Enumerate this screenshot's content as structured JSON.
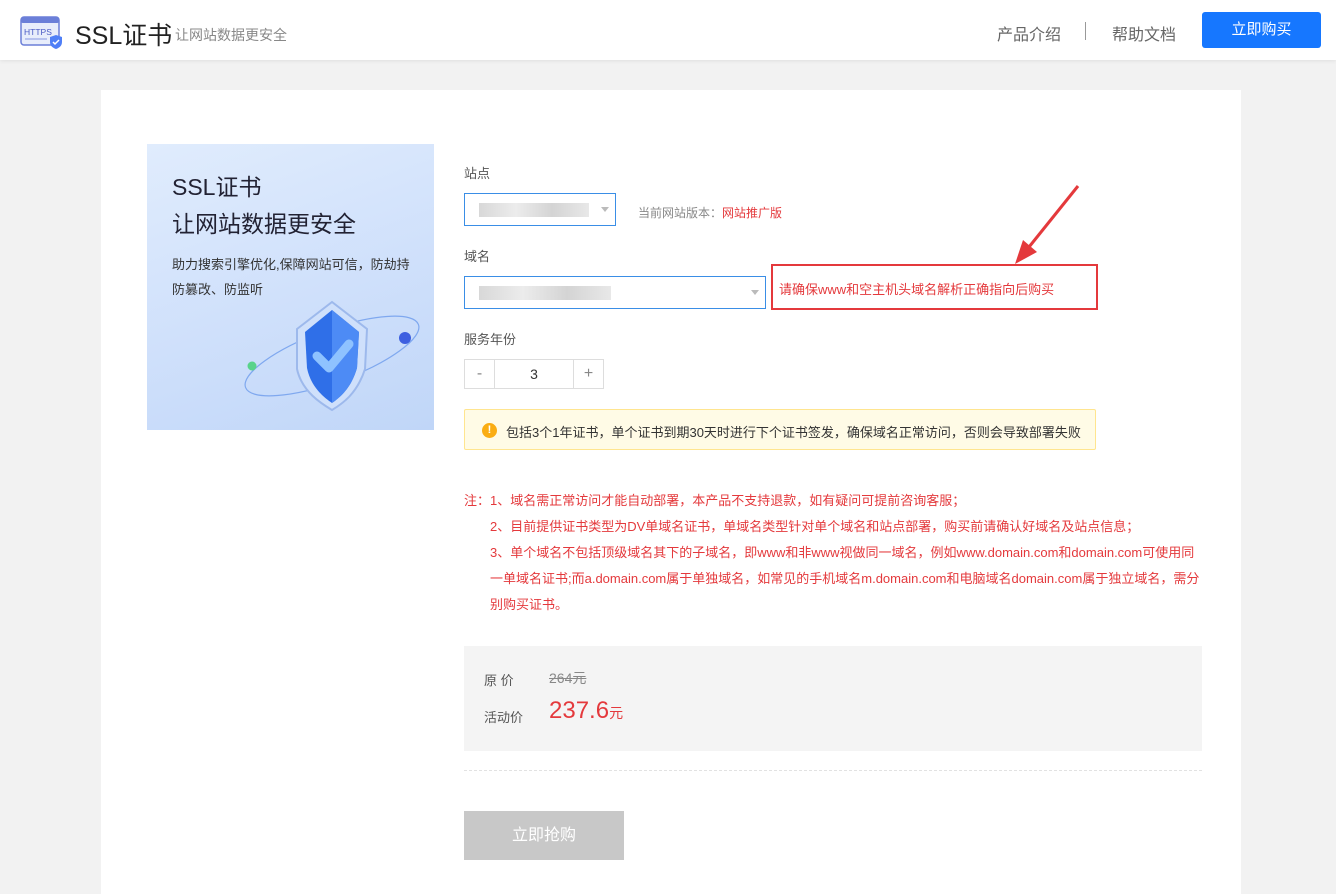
{
  "header": {
    "brand": "SSL证书",
    "tagline": "让网站数据更安全",
    "logo_icon": "https-certificate-icon",
    "nav": [
      "产品介绍",
      "帮助文档"
    ],
    "buy_label": "立即购买",
    "accent_color": "#1677ff"
  },
  "banner": {
    "title_line1": "SSL证书",
    "title_line2": "让网站数据更安全",
    "description": "助力搜索引擎优化,保障网站可信，防劫持防篡改、防监听",
    "art_icon": "shield-check-icon"
  },
  "form": {
    "site_label": "站点",
    "version_prefix": "当前网站版本：",
    "version_value": "网站推广版",
    "domain_label": "域名",
    "domain_warning": "请确保www和空主机头域名解析正确指向后购买",
    "years_label": "服务年份",
    "years_value": "3",
    "minus": "-",
    "plus": "+"
  },
  "info": {
    "icon": "exclamation-icon",
    "text": "包括3个1年证书，单个证书到期30天时进行下个证书签发，确保域名正常访问，否则会导致部署失败"
  },
  "notes": {
    "prefix": "注：",
    "items": [
      "1、域名需正常访问才能自动部署，本产品不支持退款，如有疑问可提前咨询客服；",
      "2、目前提供证书类型为DV单域名证书，单域名类型针对单个域名和站点部署，购买前请确认好域名及站点信息；",
      "3、单个域名不包括顶级域名其下的子域名，即www和非www视做同一域名，例如www.domain.com和domain.com可使用同一单域名证书;而a.domain.com属于单独域名，如常见的手机域名m.domain.com和电脑域名domain.com属于独立域名，需分别购买证书。"
    ],
    "color": "#e4393c"
  },
  "price": {
    "orig_label": "原 价",
    "orig_value": "264元",
    "now_label": "活动价",
    "now_value": "237.6",
    "now_unit": "元"
  },
  "buy_main_label": "立即抢购"
}
